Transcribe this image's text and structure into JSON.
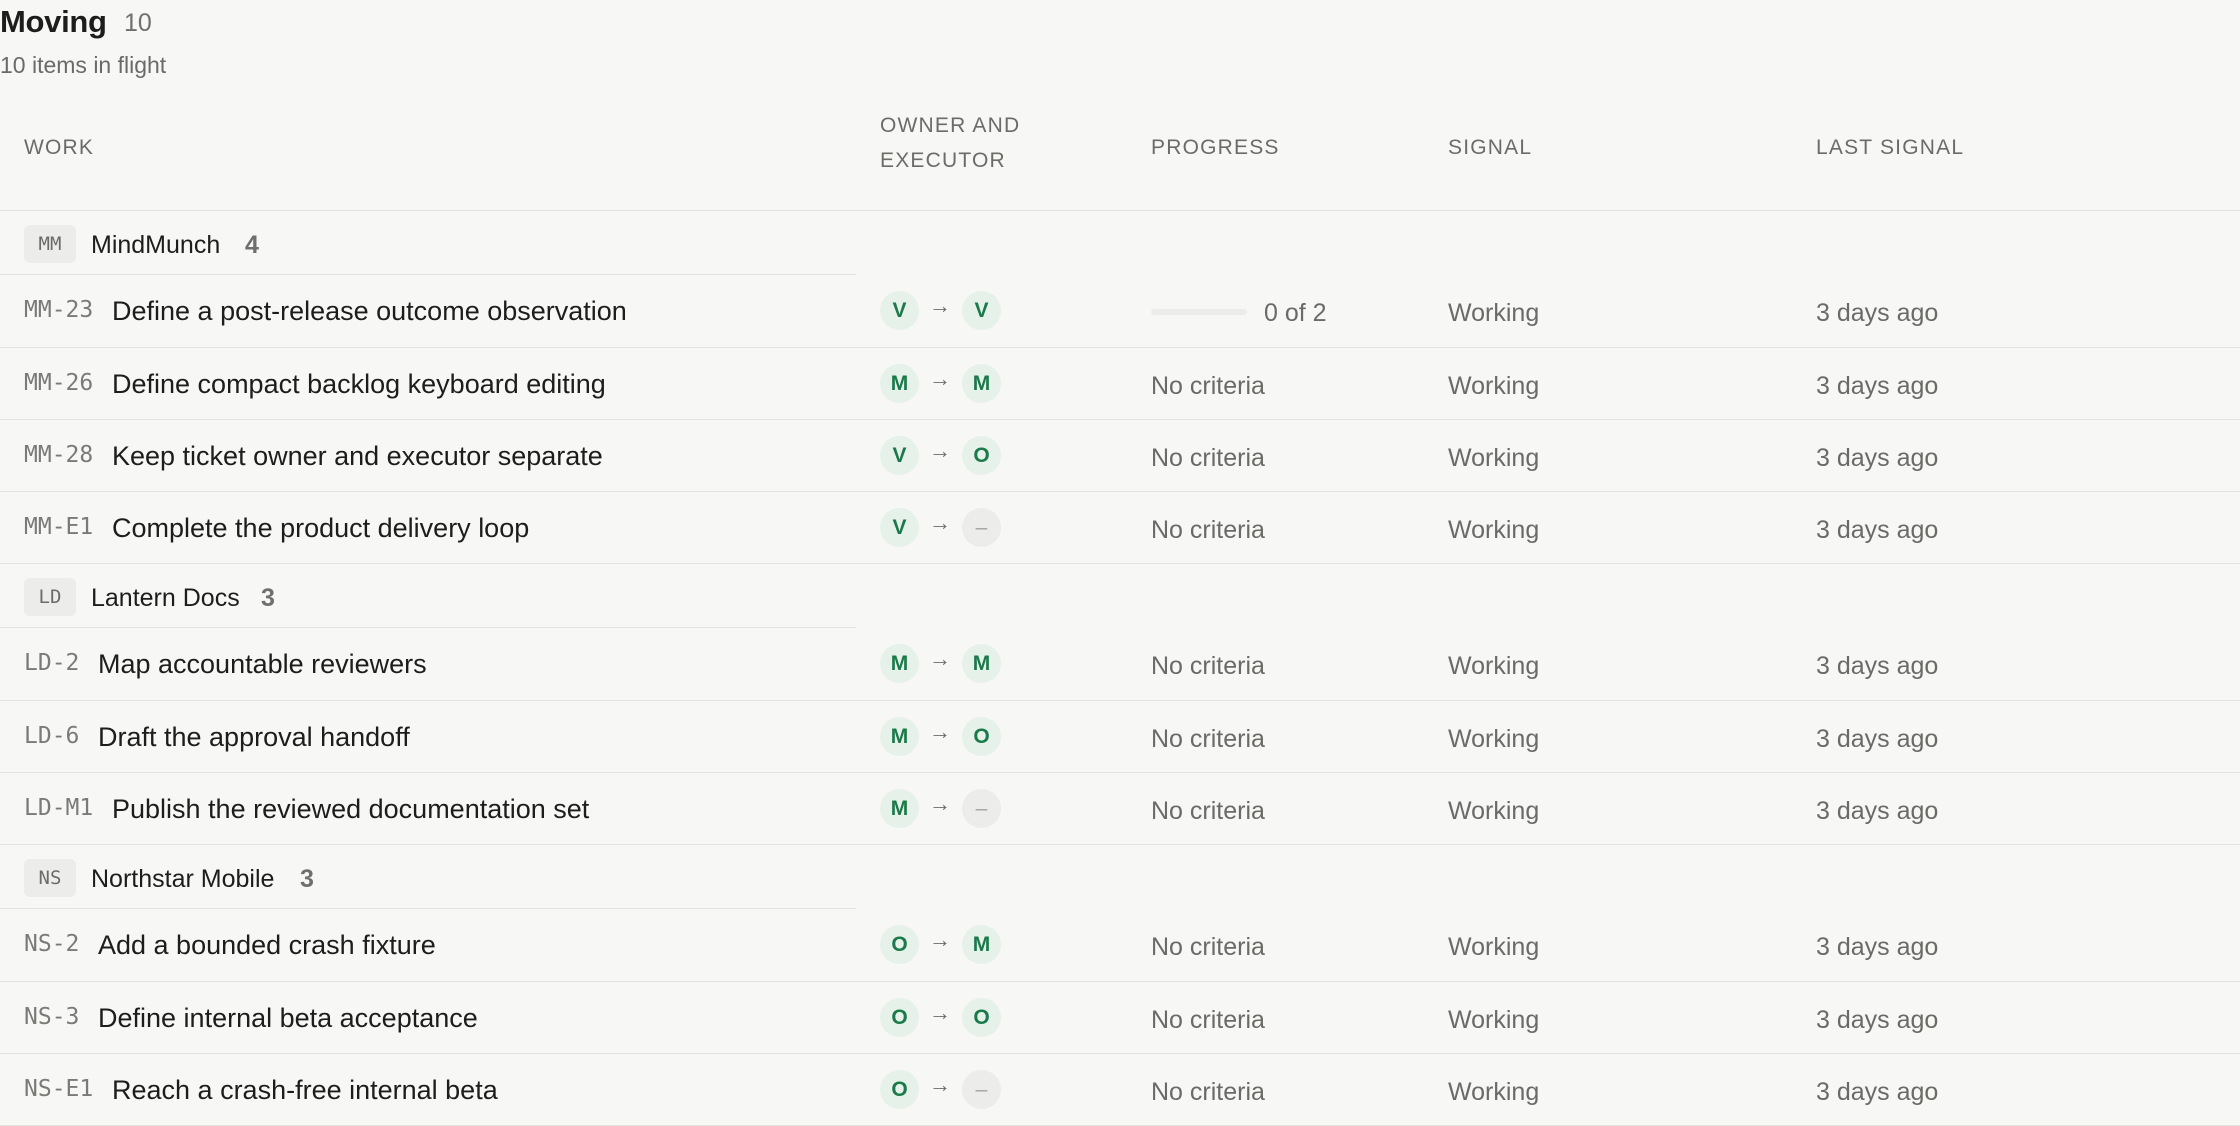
{
  "header": {
    "title": "Moving",
    "count": "10",
    "subtitle": "10 items in flight"
  },
  "columns": {
    "work": "WORK",
    "owner_line1": "OWNER AND",
    "owner_line2": "EXECUTOR",
    "progress": "PROGRESS",
    "signal": "SIGNAL",
    "last_signal": "LAST SIGNAL"
  },
  "groups": [
    {
      "badge": "MM",
      "name": "MindMunch",
      "count": "4",
      "rows": [
        {
          "id": "MM-23",
          "title": "Define a post-release outcome observation",
          "owner": "V",
          "executor": "V",
          "progress": {
            "type": "bar",
            "fraction": 0,
            "label": "0 of 2"
          },
          "signal": "Working",
          "last": "3 days ago"
        },
        {
          "id": "MM-26",
          "title": "Define compact backlog keyboard editing",
          "owner": "M",
          "executor": "M",
          "progress": {
            "type": "text",
            "label": "No criteria"
          },
          "signal": "Working",
          "last": "3 days ago"
        },
        {
          "id": "MM-28",
          "title": "Keep ticket owner and executor separate",
          "owner": "V",
          "executor": "O",
          "progress": {
            "type": "text",
            "label": "No criteria"
          },
          "signal": "Working",
          "last": "3 days ago"
        },
        {
          "id": "MM-E1",
          "title": "Complete the product delivery loop",
          "owner": "V",
          "executor": "–",
          "progress": {
            "type": "text",
            "label": "No criteria"
          },
          "signal": "Working",
          "last": "3 days ago"
        }
      ]
    },
    {
      "badge": "LD",
      "name": "Lantern Docs",
      "count": "3",
      "rows": [
        {
          "id": "LD-2",
          "title": "Map accountable reviewers",
          "owner": "M",
          "executor": "M",
          "progress": {
            "type": "text",
            "label": "No criteria"
          },
          "signal": "Working",
          "last": "3 days ago"
        },
        {
          "id": "LD-6",
          "title": "Draft the approval handoff",
          "owner": "M",
          "executor": "O",
          "progress": {
            "type": "text",
            "label": "No criteria"
          },
          "signal": "Working",
          "last": "3 days ago"
        },
        {
          "id": "LD-M1",
          "title": "Publish the reviewed documentation set",
          "owner": "M",
          "executor": "–",
          "progress": {
            "type": "text",
            "label": "No criteria"
          },
          "signal": "Working",
          "last": "3 days ago"
        }
      ]
    },
    {
      "badge": "NS",
      "name": "Northstar Mobile",
      "count": "3",
      "rows": [
        {
          "id": "NS-2",
          "title": "Add a bounded crash fixture",
          "owner": "O",
          "executor": "M",
          "progress": {
            "type": "text",
            "label": "No criteria"
          },
          "signal": "Working",
          "last": "3 days ago"
        },
        {
          "id": "NS-3",
          "title": "Define internal beta acceptance",
          "owner": "O",
          "executor": "O",
          "progress": {
            "type": "text",
            "label": "No criteria"
          },
          "signal": "Working",
          "last": "3 days ago"
        },
        {
          "id": "NS-E1",
          "title": "Reach a crash-free internal beta",
          "owner": "O",
          "executor": "–",
          "progress": {
            "type": "text",
            "label": "No criteria"
          },
          "signal": "Working",
          "last": "3 days ago"
        }
      ]
    }
  ],
  "icons": {
    "handoff_arrow": "arrow-right-icon",
    "arrow_glyph": "→"
  },
  "colors": {
    "accent": "#1b7a4a",
    "avatar_bg": "#e6f1ea",
    "background": "#f7f7f6"
  }
}
